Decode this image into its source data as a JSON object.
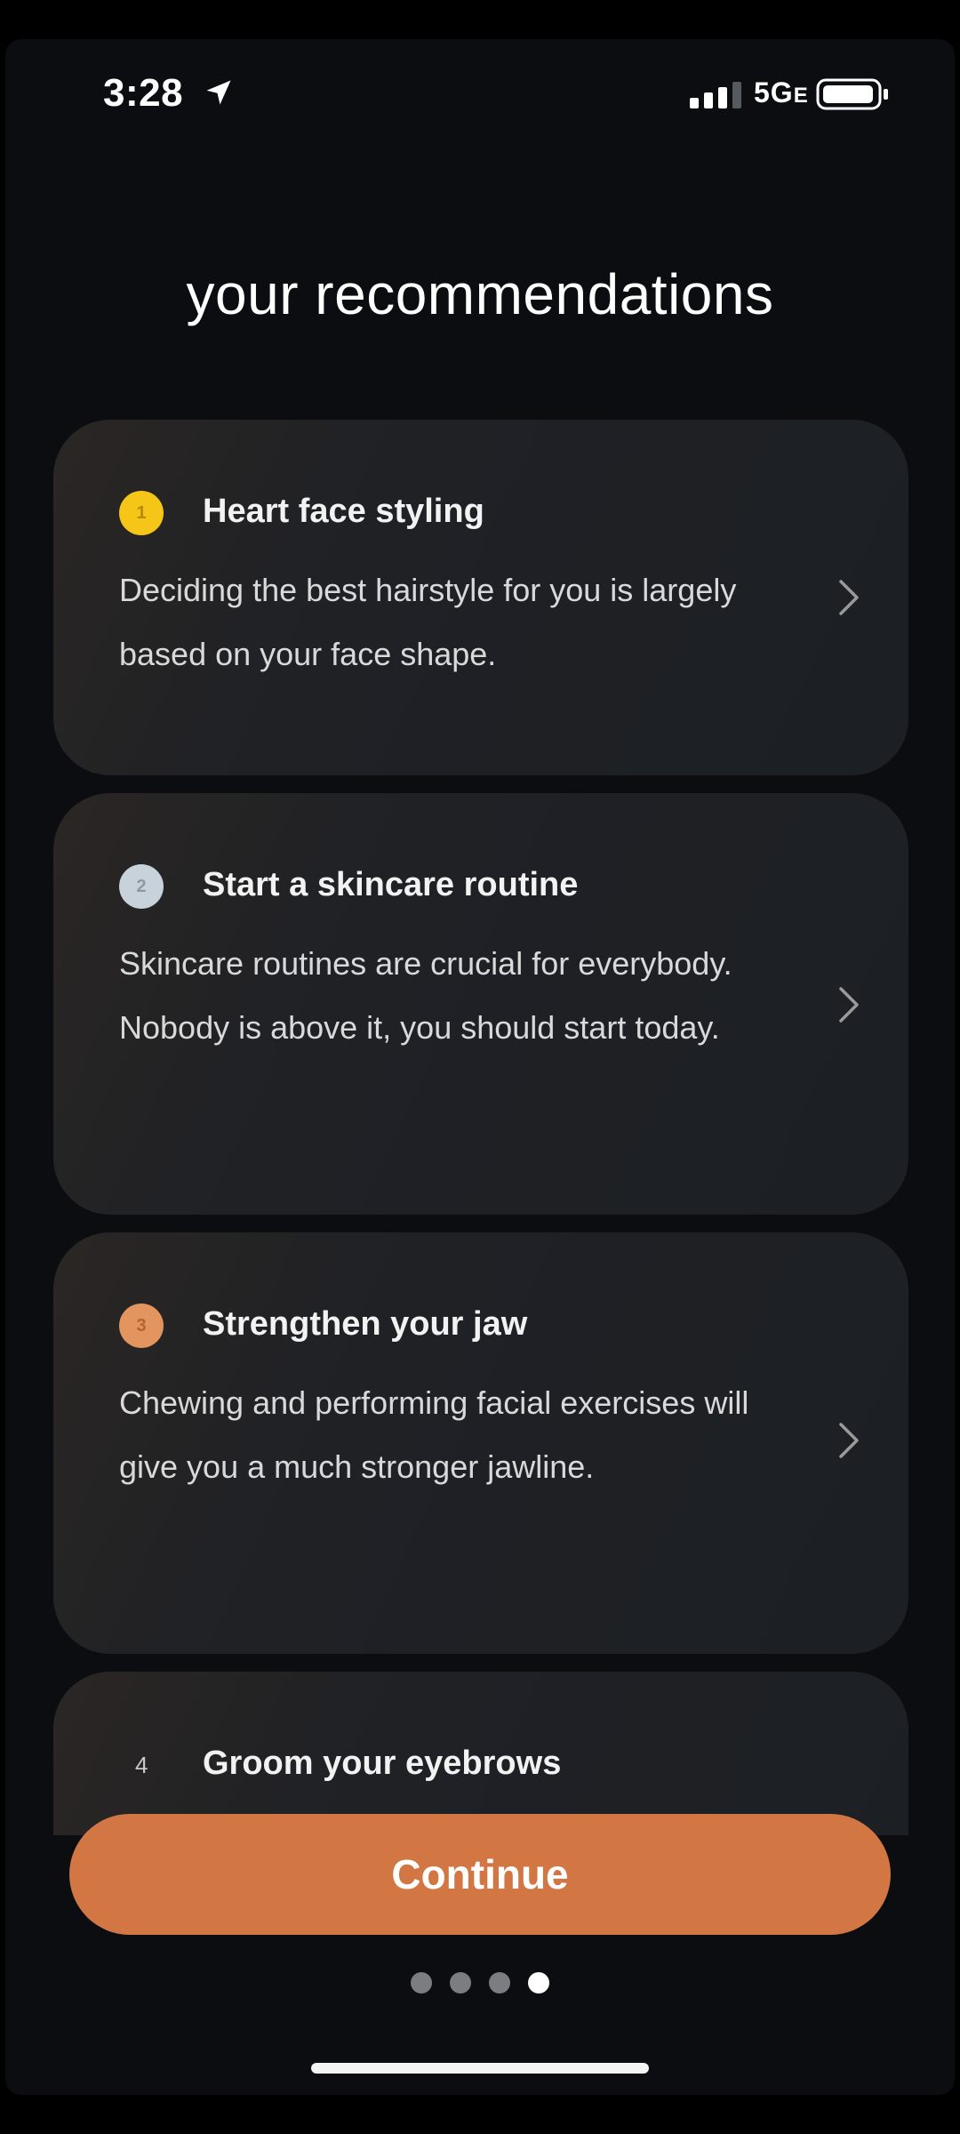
{
  "status_bar": {
    "time": "3:28",
    "network": "5G",
    "network_suffix": "E",
    "location_icon": "location-arrow-icon",
    "signal_icon": "cellular-signal-icon",
    "battery_icon": "battery-icon"
  },
  "page": {
    "title": "your recommendations"
  },
  "recommendations": [
    {
      "badge": "1",
      "badge_color": "#f5c518",
      "title": "Heart face styling",
      "description": "Deciding the best hairstyle for you is largely based on your face shape."
    },
    {
      "badge": "2",
      "badge_color": "#c8d2da",
      "title": "Start a skincare routine",
      "description": "Skincare routines are crucial for everybody. Nobody is above it, you should start today."
    },
    {
      "badge": "3",
      "badge_color": "#e2955e",
      "title": "Strengthen your jaw",
      "description": "Chewing and performing facial exercises will give you a much stronger jawline."
    },
    {
      "badge": "4",
      "title": "Groom your eyebrows"
    }
  ],
  "footer": {
    "continue_label": "Continue",
    "accent_color": "#d27744",
    "page_dots_total": 4,
    "page_dots_active": 4
  }
}
